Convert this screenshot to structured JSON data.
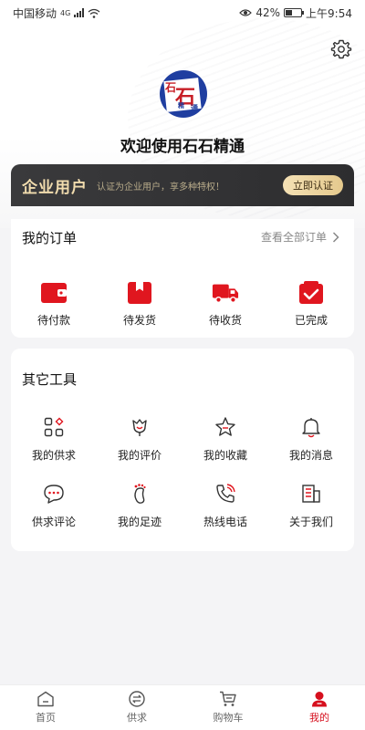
{
  "status_bar": {
    "carrier": "中国移动",
    "network": "4G",
    "battery": "42%",
    "time": "上午9:54"
  },
  "header": {
    "welcome": "欢迎使用石石精通",
    "logo_text": [
      "石",
      "石",
      "精",
      "通"
    ]
  },
  "enterprise": {
    "title": "企业用户",
    "desc": "认证为企业用户，享多种特权！",
    "button": "立即认证"
  },
  "orders": {
    "title": "我的订单",
    "view_all": "查看全部订单",
    "items": [
      {
        "label": "待付款",
        "icon": "wallet-icon"
      },
      {
        "label": "待发货",
        "icon": "package-icon"
      },
      {
        "label": "待收货",
        "icon": "truck-icon"
      },
      {
        "label": "已完成",
        "icon": "completed-icon"
      }
    ]
  },
  "tools": {
    "title": "其它工具",
    "items": [
      {
        "label": "我的供求",
        "icon": "grid-icon"
      },
      {
        "label": "我的评价",
        "icon": "flower-icon"
      },
      {
        "label": "我的收藏",
        "icon": "star-icon"
      },
      {
        "label": "我的消息",
        "icon": "bell-icon"
      },
      {
        "label": "供求评论",
        "icon": "comment-icon"
      },
      {
        "label": "我的足迹",
        "icon": "footprint-icon"
      },
      {
        "label": "热线电话",
        "icon": "phone-icon"
      },
      {
        "label": "关于我们",
        "icon": "building-icon"
      }
    ]
  },
  "tabbar": {
    "items": [
      {
        "label": "首页",
        "icon": "home-icon",
        "active": false
      },
      {
        "label": "供求",
        "icon": "exchange-icon",
        "active": false
      },
      {
        "label": "购物车",
        "icon": "cart-icon",
        "active": false
      },
      {
        "label": "我的",
        "icon": "user-icon",
        "active": true
      }
    ]
  },
  "colors": {
    "accent": "#d6101e",
    "gold": "#f1dcae",
    "dark": "#2d2d2f"
  }
}
